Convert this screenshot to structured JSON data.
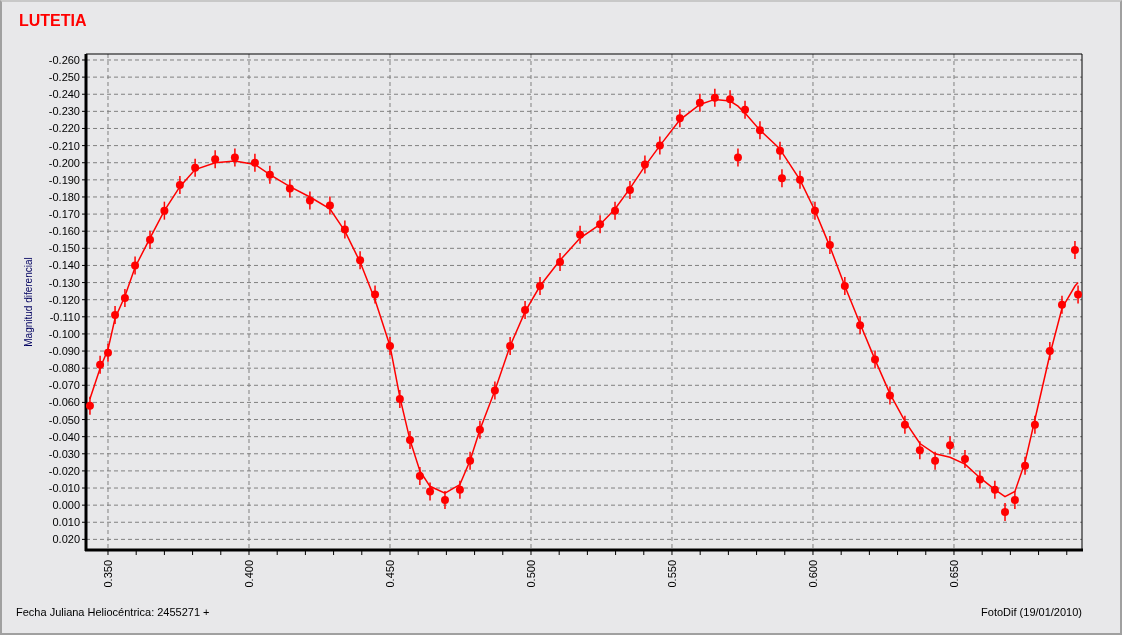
{
  "window": {
    "title": "LUTETIA"
  },
  "chart": {
    "chart_data": {
      "type": "scatter",
      "ylabel": "Magnitud diferencial",
      "xlim": [
        0.3422,
        0.6954
      ],
      "ylim": [
        0.0262,
        -0.2635
      ],
      "x": [
        0.3436,
        0.3472,
        0.35,
        0.3525,
        0.356,
        0.3596,
        0.3649,
        0.37,
        0.3755,
        0.3809,
        0.388,
        0.395,
        0.4021,
        0.4074,
        0.4145,
        0.4216,
        0.4287,
        0.434,
        0.4394,
        0.4447,
        0.45,
        0.4535,
        0.4571,
        0.4606,
        0.4642,
        0.4695,
        0.4748,
        0.4784,
        0.4819,
        0.4872,
        0.4926,
        0.4979,
        0.5032,
        0.5103,
        0.5174,
        0.5245,
        0.5298,
        0.5351,
        0.5404,
        0.5457,
        0.5528,
        0.5599,
        0.5652,
        0.5706,
        0.5734,
        0.5759,
        0.5812,
        0.5883,
        0.589,
        0.5954,
        0.6007,
        0.606,
        0.6113,
        0.6167,
        0.622,
        0.6273,
        0.6326,
        0.6379,
        0.6433,
        0.6486,
        0.6539,
        0.6592,
        0.6645,
        0.6681,
        0.6716,
        0.6752,
        0.6787,
        0.684,
        0.6883,
        0.6929,
        0.694
      ],
      "grid": true,
      "series": [
        {
          "type": "line",
          "color": "#ff0000",
          "values": [
            -0.062,
            -0.08,
            -0.091,
            -0.109,
            -0.122,
            -0.139,
            -0.156,
            -0.172,
            -0.186,
            -0.196,
            -0.2,
            -0.201,
            -0.199,
            -0.193,
            -0.186,
            -0.18,
            -0.173,
            -0.16,
            -0.142,
            -0.12,
            -0.093,
            -0.063,
            -0.038,
            -0.02,
            -0.011,
            -0.007,
            -0.012,
            -0.026,
            -0.044,
            -0.067,
            -0.093,
            -0.113,
            -0.128,
            -0.143,
            -0.156,
            -0.164,
            -0.173,
            -0.185,
            -0.198,
            -0.21,
            -0.225,
            -0.234,
            -0.237,
            -0.236,
            -0.233,
            -0.229,
            -0.219,
            -0.208,
            -0.206,
            -0.19,
            -0.172,
            -0.151,
            -0.128,
            -0.106,
            -0.085,
            -0.065,
            -0.049,
            -0.036,
            -0.03,
            -0.028,
            -0.024,
            -0.016,
            -0.009,
            -0.005,
            -0.008,
            -0.025,
            -0.05,
            -0.088,
            -0.115,
            -0.128,
            -0.13
          ]
        },
        {
          "type": "scatter",
          "color": "#ff0000",
          "values": [
            -0.058,
            -0.082,
            -0.089,
            -0.111,
            -0.121,
            -0.14,
            -0.155,
            -0.172,
            -0.187,
            -0.197,
            -0.202,
            -0.203,
            -0.2,
            -0.193,
            -0.185,
            -0.178,
            -0.175,
            -0.161,
            -0.143,
            -0.123,
            -0.093,
            -0.062,
            -0.038,
            -0.017,
            -0.008,
            -0.003,
            -0.009,
            -0.026,
            -0.044,
            -0.067,
            -0.093,
            -0.114,
            -0.128,
            -0.142,
            -0.158,
            -0.164,
            -0.172,
            -0.184,
            -0.199,
            -0.21,
            -0.226,
            -0.235,
            -0.238,
            -0.237,
            -0.203,
            -0.231,
            -0.219,
            -0.207,
            -0.191,
            -0.19,
            -0.172,
            -0.152,
            -0.128,
            -0.105,
            -0.085,
            -0.064,
            -0.047,
            -0.032,
            -0.026,
            -0.035,
            -0.027,
            -0.015,
            -0.009,
            0.004,
            -0.003,
            -0.023,
            -0.047,
            -0.09,
            -0.117,
            -0.149,
            -0.123
          ]
        }
      ],
      "xticks": [
        {
          "value": 0.35,
          "label": "0.350"
        },
        {
          "value": 0.4,
          "label": "0.400"
        },
        {
          "value": 0.45,
          "label": "0.450"
        },
        {
          "value": 0.5,
          "label": "0.500"
        },
        {
          "value": 0.55,
          "label": "0.550"
        },
        {
          "value": 0.6,
          "label": "0.600"
        },
        {
          "value": 0.65,
          "label": "0.650"
        }
      ],
      "yticks": [
        {
          "value": -0.26,
          "label": "-0.260"
        },
        {
          "value": -0.25,
          "label": "-0.250"
        },
        {
          "value": -0.24,
          "label": "-0.240"
        },
        {
          "value": -0.23,
          "label": "-0.230"
        },
        {
          "value": -0.22,
          "label": "-0.220"
        },
        {
          "value": -0.21,
          "label": "-0.210"
        },
        {
          "value": -0.2,
          "label": "-0.200"
        },
        {
          "value": -0.19,
          "label": "-0.190"
        },
        {
          "value": -0.18,
          "label": "-0.180"
        },
        {
          "value": -0.17,
          "label": "-0.170"
        },
        {
          "value": -0.16,
          "label": "-0.160"
        },
        {
          "value": -0.15,
          "label": "-0.150"
        },
        {
          "value": -0.14,
          "label": "-0.140"
        },
        {
          "value": -0.13,
          "label": "-0.130"
        },
        {
          "value": -0.12,
          "label": "-0.120"
        },
        {
          "value": -0.11,
          "label": "-0.110"
        },
        {
          "value": -0.1,
          "label": "-0.100"
        },
        {
          "value": -0.09,
          "label": "-0.090"
        },
        {
          "value": -0.08,
          "label": "-0.080"
        },
        {
          "value": -0.07,
          "label": "-0.070"
        },
        {
          "value": -0.06,
          "label": "-0.060"
        },
        {
          "value": -0.05,
          "label": "-0.050"
        },
        {
          "value": -0.04,
          "label": "-0.040"
        },
        {
          "value": -0.03,
          "label": "-0.030"
        },
        {
          "value": -0.02,
          "label": "-0.020"
        },
        {
          "value": -0.01,
          "label": "-0.010"
        },
        {
          "value": 0,
          "label": "0.000"
        },
        {
          "value": 0.01,
          "label": "0.010"
        },
        {
          "value": 0.02,
          "label": "0.020"
        }
      ]
    }
  },
  "footer": {
    "left": "Fecha Juliana Heliocéntrica: 2455271 +",
    "right": "FotoDif (19/01/2010)"
  }
}
